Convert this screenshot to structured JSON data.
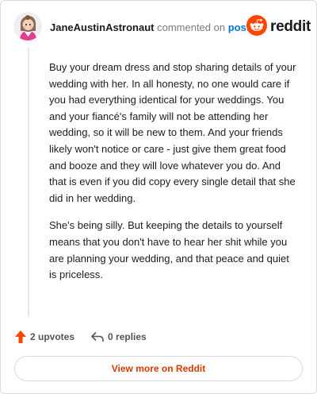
{
  "comment": {
    "username": "JaneAustinAstronaut",
    "action_text": "commented on",
    "post_link_text": "post",
    "paragraphs": [
      "Buy your dream dress and stop sharing details of your wedding with her. In all honesty, no one would care if you had everything identical for your weddings. You and your fiancé's family will not be attending her wedding, so it will be new to them. And your friends likely won't notice or care - just give them great food and booze and they will love whatever you do. And that is even if you did copy every single detail that she did in her wedding.",
      "She's being silly. But keeping the details to yourself means that you don't have to hear her shit while you are planning your wedding, and that peace and quiet is priceless."
    ]
  },
  "brand": {
    "logo_text": "reddit",
    "icon": "reddit-snoo-icon",
    "accent_color": "#ff4500"
  },
  "actions": {
    "upvotes_label": "2 upvotes",
    "replies_label": "0 replies",
    "upvote_icon": "upvote-arrow-icon",
    "reply_icon": "reply-arrow-icon",
    "upvote_color": "#ff4500"
  },
  "footer": {
    "view_more_label": "View more on Reddit",
    "view_more_color": "#d93a00"
  }
}
